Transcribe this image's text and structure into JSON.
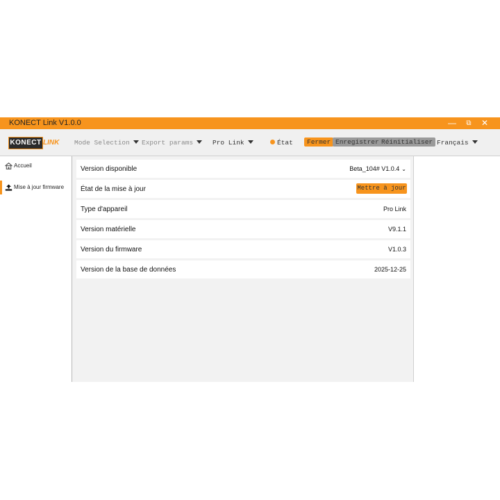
{
  "window": {
    "title": "KONECT Link V1.0.0"
  },
  "window_controls": {
    "minimize": "—",
    "restore": "⧉",
    "close": "✕"
  },
  "logo": {
    "brand": "KONECT",
    "suffix": "LINK"
  },
  "toolbar": {
    "mode_selection": "Mode Selection",
    "export_params": "Export params",
    "pro_link": "Pro Link",
    "status": "État",
    "close_label": "Fermer",
    "save_label": "Enregistrer",
    "reset_label": "Réinitialiser",
    "language": "Français"
  },
  "sidebar": {
    "items": [
      {
        "label": "Accueil",
        "icon": "home-icon",
        "active": false
      },
      {
        "label": "Mise à jour firmware",
        "icon": "upload-icon",
        "active": true
      }
    ]
  },
  "firmware": {
    "rows": [
      {
        "key": "Version disponible",
        "value": "Beta_104# V1.0.4"
      },
      {
        "key": "État de la mise à jour",
        "button": "Mettre à jour"
      },
      {
        "key": "Type d'appareil",
        "value": "Pro Link"
      },
      {
        "key": "Version matérielle",
        "value": "V9.1.1"
      },
      {
        "key": "Version du firmware",
        "value": "V1.0.3"
      },
      {
        "key": "Version de la base de données",
        "value": "2025-12-25"
      }
    ]
  },
  "colors": {
    "accent": "#f7941d",
    "button_gray": "#9a9a9a",
    "panel_bg": "#f2f2f2"
  }
}
